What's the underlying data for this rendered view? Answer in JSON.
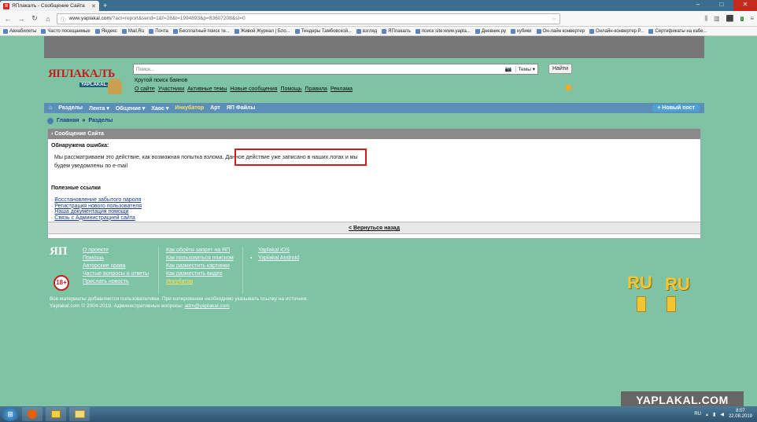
{
  "browser": {
    "tab_title": "ЯПлакалъ - Сообщение Сайта",
    "tab_favicon_text": "Я",
    "url_host": "www.yaplakal.com",
    "url_path": "/?act=report&send=1&f=28&t=1994893&p=83607208&st=0",
    "badge_num": "1"
  },
  "bookmarks": [
    "Авиабилеты",
    "Часто посещаемые",
    "Яндекс",
    "Mail.Ru",
    "Почта",
    "Бесплатный поиск те...",
    "Живой Журнал | Бло...",
    "Тендеры Тамбовской...",
    "взгляд",
    "ЯПлакалъ",
    "поиск site:www.yapla...",
    "Дневник.ру",
    "кубики",
    "Он-лайн конвертер",
    "Онлайн-конвертер Р...",
    "Сертификаты на кабе..."
  ],
  "site": {
    "logo_text": "ЯПЛАКАЛЪ",
    "logo_sub": "YAPLAKAL.COM",
    "search_placeholder": "Поиск...",
    "search_scope": "Темы ▾",
    "find_button": "Найти",
    "slogan": "Крутой поиск баянов",
    "top_links": [
      "О сайте",
      "Участники",
      "Активные темы",
      "Новые сообщения",
      "Помощь",
      "Правила",
      "Реклама"
    ]
  },
  "nav": {
    "items": [
      "Разделы",
      "Лента ▾",
      "Общение ▾",
      "Хаос ▾",
      "Инкубатор",
      "Арт",
      "ЯП Файлы"
    ],
    "new_post": "Новый пост"
  },
  "breadcrumb": {
    "home": "Главная",
    "sep": "»",
    "current": "Разделы"
  },
  "panel": {
    "header": "› Сообщение Сайта",
    "error_title": "Обнаружена ошибка:",
    "error_text_1": "Мы рассматриваем это действие, как возможная попытка взлома. Данное действие уже записано в наших логах и мы",
    "error_text_2": "будем уведомлены по e-mail",
    "useful_title": "Полезные ссылки",
    "useful_links": [
      "Восстановление забытого пароля",
      "Регистрация нового пользователя",
      "Наша документация помощи",
      "Связь с Администрацией сайта"
    ],
    "useful_prefix": "·",
    "back_link": "< Вернуться назад"
  },
  "footer": {
    "logo": "ЯП",
    "age_badge": "18+",
    "col1": [
      "О проекте",
      "Помощь",
      "Авторские права",
      "Частые вопросы и ответы",
      "Прислать новость"
    ],
    "col2": [
      "Как обойти запрет на ЯП",
      "Как пользоваться поиском",
      "Как разместить картинки",
      "Как разместить видео",
      "Инкубатор"
    ],
    "col3": [
      "Yaplakal iOS",
      "Yaplakal Android"
    ],
    "copyright_1": "Все материалы добавляются пользователями. При копировании необходимо указывать ссылку на источник.",
    "copyright_2": "Yaplakal.com © 2004-2019. Административные вопросы:",
    "admin_email": "adm@yaplakal.com"
  },
  "ru_logo": {
    "left": "RU",
    "right": "RU"
  },
  "watermark": "YAPLAKAL.COM",
  "taskbar": {
    "lang": "RU",
    "time": "8:07",
    "date": "22.08.2019"
  }
}
